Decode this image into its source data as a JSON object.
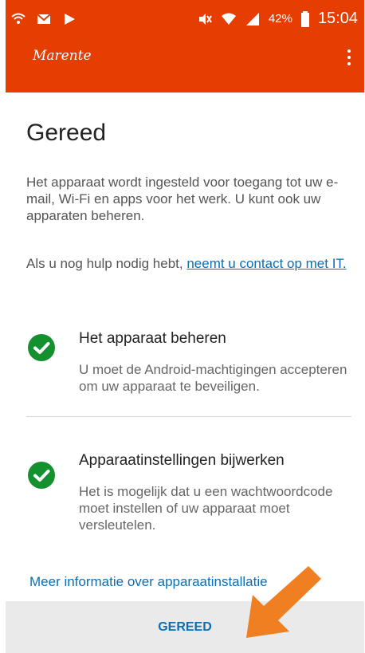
{
  "status_bar": {
    "battery": "42%",
    "time": "15:04",
    "icons_left": [
      "wifi-signal-icon",
      "gmail-icon",
      "play-store-icon"
    ],
    "icons_right": [
      "mute-icon",
      "wifi-icon",
      "cell-signal-icon",
      "battery-icon"
    ]
  },
  "app_bar": {
    "logo": "Marente",
    "menu_icon": "more-vert-icon"
  },
  "content": {
    "title": "Gereed",
    "intro": "Het apparaat wordt ingesteld voor toegang tot uw e-mail, Wi-Fi en apps voor het werk. U kunt ook uw apparaten beheren.",
    "help_prefix": "Als u nog hulp nodig hebt, ",
    "help_link": "neemt u contact op met IT.",
    "items": [
      {
        "title": "Het apparaat beheren",
        "description": "U moet de Android-machtigingen accepteren om uw apparaat te beveiligen.",
        "status": "completed"
      },
      {
        "title": "Apparaatinstellingen bijwerken",
        "description": "Het is mogelijk dat u een wachtwoordcode moet instellen of uw apparaat moet versleutelen.",
        "status": "completed"
      }
    ],
    "more_info_link": "Meer informatie over apparaatinstallatie"
  },
  "footer": {
    "done_button": "GEREED"
  },
  "colors": {
    "brand": "#e63d02",
    "check": "#14912e",
    "link": "#0a6fb5",
    "arrow": "#f07f22"
  }
}
